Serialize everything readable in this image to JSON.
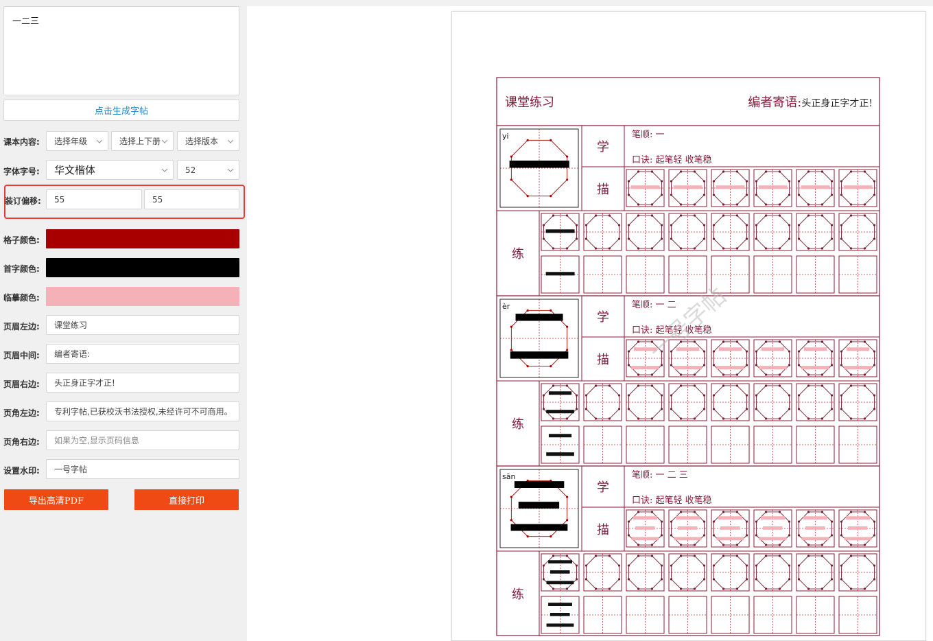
{
  "input": {
    "text": "一二三"
  },
  "generate_button": "点击生成字帖",
  "rows": {
    "content_label": "课本内容:",
    "grade_select": "选择年级",
    "term_select": "选择上下册",
    "edition_select": "选择版本",
    "font_label": "字体字号:",
    "font_select": "华文楷体",
    "size_select": "52",
    "offset_label": "装订偏移:",
    "offset_x": "55",
    "offset_y": "55",
    "grid_color_label": "格子颜色:",
    "first_color_label": "首字颜色:",
    "trace_color_label": "临摹颜色:",
    "header_left_label": "页眉左边:",
    "header_left_value": "课堂练习",
    "header_mid_label": "页眉中间:",
    "header_mid_value": "编者寄语:",
    "header_right_label": "页眉右边:",
    "header_right_value": "头正身正字才正!",
    "footer_left_label": "页角左边:",
    "footer_left_value": "专利字帖,已获校沃书法授权,未经许可不可商用。",
    "footer_right_label": "页角右边:",
    "footer_right_placeholder": "如果为空,显示页码信息",
    "watermark_label": "设置水印:",
    "watermark_value": "一号字帖"
  },
  "colors": {
    "grid": "#a80000",
    "first": "#000000",
    "trace": "#f5b1b8",
    "accent": "#f04a14",
    "link": "#1e88c7"
  },
  "export_button": "导出高清PDF",
  "print_button": "直接打印",
  "sheet": {
    "header_left": "课堂练习",
    "header_right_title": "编者寄语:",
    "header_right_text": "头正身正字才正!",
    "learn_label": "学",
    "trace_label": "描",
    "practice_label": "练",
    "stroke_label": "笔顺:",
    "tip_label": "口诀:",
    "tip_text": "起笔轻 收笔稳",
    "watermark": "一号字帖",
    "chars": [
      {
        "char": "一",
        "pinyin": "yi",
        "strokes": "一"
      },
      {
        "char": "二",
        "pinyin": "èr",
        "strokes": "一 二"
      },
      {
        "char": "三",
        "pinyin": "sān",
        "strokes": "一 二 三"
      }
    ]
  }
}
